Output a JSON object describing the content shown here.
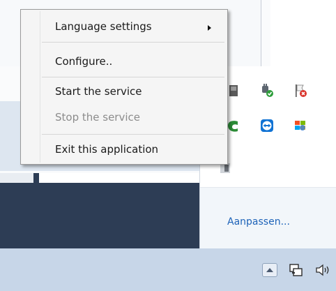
{
  "context_menu": {
    "items": [
      {
        "label": "Language settings",
        "has_submenu": true,
        "enabled": true
      },
      {
        "label": "Configure..",
        "enabled": true
      },
      {
        "label": "Start the service",
        "enabled": true
      },
      {
        "label": "Stop the service",
        "enabled": false
      },
      {
        "label": "Exit this application",
        "enabled": true
      }
    ]
  },
  "tray_popup": {
    "customize_link": "Aanpassen..."
  },
  "icons": {
    "tray": [
      "usb-device-icon",
      "plug-check-icon",
      "flag-error-icon",
      "green-app-icon",
      "teamviewer-icon",
      "windows-update-icon",
      "gray-app-icon"
    ],
    "taskbar": [
      "show-hidden-icons-icon",
      "network-icon",
      "volume-icon"
    ]
  },
  "colors": {
    "menu_bg": "#f5f5f5",
    "disabled_text": "#8c8c8c",
    "link": "#1e63b8",
    "taskbar": "#c7d6e8"
  }
}
